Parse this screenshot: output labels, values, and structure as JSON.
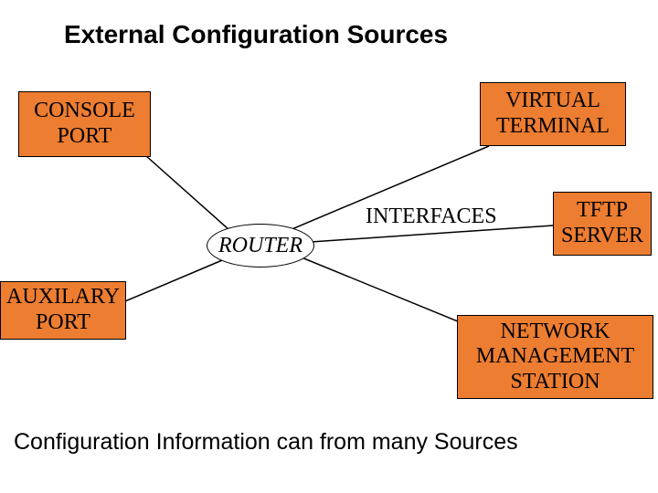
{
  "title": "External Configuration Sources",
  "boxes": {
    "console_port": "CONSOLE PORT",
    "virtual_terminal": "VIRTUAL TERMINAL",
    "tftp_server": "TFTP SERVER",
    "auxilary_port": "AUXILARY PORT",
    "nms": "NETWORK MANAGEMENT STATION"
  },
  "router_label": "ROUTER",
  "interfaces_label": "INTERFACES",
  "caption": "Configuration Information can from many Sources"
}
